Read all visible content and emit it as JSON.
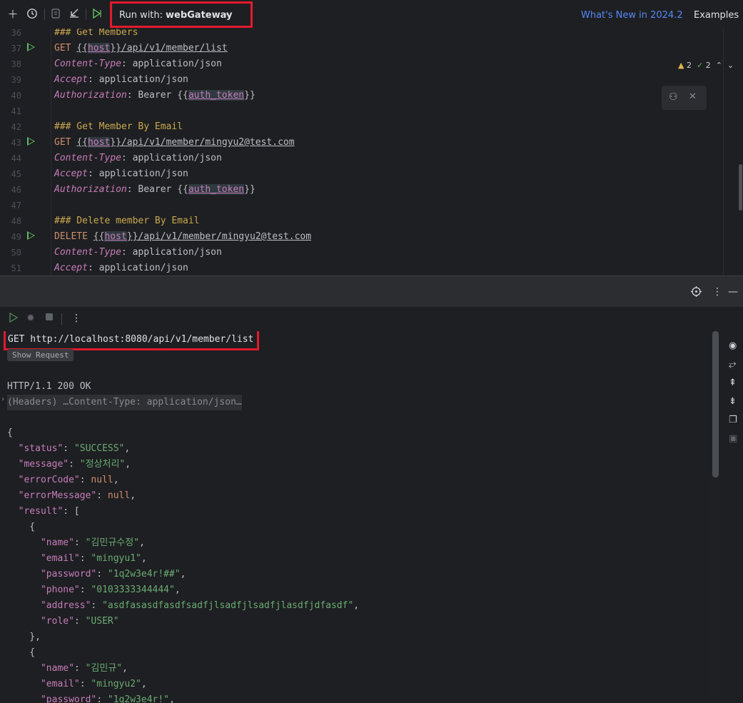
{
  "toolbar": {
    "run_with_label": "Run with:",
    "run_with_value": "webGateway",
    "whats_new": "What's New in 2024.2",
    "examples": "Examples"
  },
  "inspection": {
    "warnings": "2",
    "ok": "2"
  },
  "editor": {
    "lines": [
      {
        "n": "36",
        "tokens": [
          {
            "t": "### Get Members",
            "c": "comment"
          }
        ]
      },
      {
        "n": "37",
        "run": true,
        "tokens": [
          {
            "t": "GET ",
            "c": "method"
          },
          {
            "t": "{{",
            "c": "url"
          },
          {
            "t": "host",
            "c": "var"
          },
          {
            "t": "}}/api/v1/member/list",
            "c": "url"
          }
        ]
      },
      {
        "n": "38",
        "tokens": [
          {
            "t": "Content-Type",
            "c": "header"
          },
          {
            "t": ": application/json",
            "c": "plain"
          }
        ]
      },
      {
        "n": "39",
        "tokens": [
          {
            "t": "Accept",
            "c": "header"
          },
          {
            "t": ": application/json",
            "c": "plain"
          }
        ]
      },
      {
        "n": "40",
        "tokens": [
          {
            "t": "Authorization",
            "c": "header"
          },
          {
            "t": ": Bearer {{",
            "c": "plain"
          },
          {
            "t": "auth_token",
            "c": "var"
          },
          {
            "t": "}}",
            "c": "plain"
          }
        ]
      },
      {
        "n": "41",
        "tokens": []
      },
      {
        "n": "42",
        "tokens": [
          {
            "t": "### Get Member By Email",
            "c": "comment"
          }
        ]
      },
      {
        "n": "43",
        "run": true,
        "tokens": [
          {
            "t": "GET ",
            "c": "method"
          },
          {
            "t": "{{",
            "c": "url"
          },
          {
            "t": "host",
            "c": "var"
          },
          {
            "t": "}}/api/v1/member/mingyu2@test.com",
            "c": "url"
          }
        ]
      },
      {
        "n": "44",
        "tokens": [
          {
            "t": "Content-Type",
            "c": "header"
          },
          {
            "t": ": application/json",
            "c": "plain"
          }
        ]
      },
      {
        "n": "45",
        "tokens": [
          {
            "t": "Accept",
            "c": "header"
          },
          {
            "t": ": application/json",
            "c": "plain"
          }
        ]
      },
      {
        "n": "46",
        "tokens": [
          {
            "t": "Authorization",
            "c": "header"
          },
          {
            "t": ": Bearer {{",
            "c": "plain"
          },
          {
            "t": "auth_token",
            "c": "var"
          },
          {
            "t": "}}",
            "c": "plain"
          }
        ]
      },
      {
        "n": "47",
        "tokens": []
      },
      {
        "n": "48",
        "tokens": [
          {
            "t": "### Delete member By Email",
            "c": "comment"
          }
        ]
      },
      {
        "n": "49",
        "run": true,
        "tokens": [
          {
            "t": "DELETE ",
            "c": "method"
          },
          {
            "t": "{{",
            "c": "url"
          },
          {
            "t": "host",
            "c": "var"
          },
          {
            "t": "}}/api/v1/member/mingyu2@test.com",
            "c": "url"
          }
        ]
      },
      {
        "n": "50",
        "tokens": [
          {
            "t": "Content-Type",
            "c": "header"
          },
          {
            "t": ": application/json",
            "c": "plain"
          }
        ]
      },
      {
        "n": "51",
        "tokens": [
          {
            "t": "Accept",
            "c": "header"
          },
          {
            "t": ": application/json",
            "c": "plain"
          }
        ]
      }
    ]
  },
  "response": {
    "request_line": "GET http://localhost:8080/api/v1/member/list",
    "show_request": "Show Request",
    "status_line": "HTTP/1.1 200 OK",
    "headers_summary": "(Headers) …Content-Type: application/json…",
    "body_lines": [
      [
        {
          "t": "{",
          "c": "punc"
        }
      ],
      [
        {
          "t": "  ",
          "c": "punc"
        },
        {
          "t": "\"status\"",
          "c": "key"
        },
        {
          "t": ": ",
          "c": "punc"
        },
        {
          "t": "\"SUCCESS\"",
          "c": "str"
        },
        {
          "t": ",",
          "c": "punc"
        }
      ],
      [
        {
          "t": "  ",
          "c": "punc"
        },
        {
          "t": "\"message\"",
          "c": "key"
        },
        {
          "t": ": ",
          "c": "punc"
        },
        {
          "t": "\"정상처리\"",
          "c": "str"
        },
        {
          "t": ",",
          "c": "punc"
        }
      ],
      [
        {
          "t": "  ",
          "c": "punc"
        },
        {
          "t": "\"errorCode\"",
          "c": "key"
        },
        {
          "t": ": ",
          "c": "punc"
        },
        {
          "t": "null",
          "c": "null"
        },
        {
          "t": ",",
          "c": "punc"
        }
      ],
      [
        {
          "t": "  ",
          "c": "punc"
        },
        {
          "t": "\"errorMessage\"",
          "c": "key"
        },
        {
          "t": ": ",
          "c": "punc"
        },
        {
          "t": "null",
          "c": "null"
        },
        {
          "t": ",",
          "c": "punc"
        }
      ],
      [
        {
          "t": "  ",
          "c": "punc"
        },
        {
          "t": "\"result\"",
          "c": "key"
        },
        {
          "t": ": [",
          "c": "punc"
        }
      ],
      [
        {
          "t": "    {",
          "c": "punc"
        }
      ],
      [
        {
          "t": "      ",
          "c": "punc"
        },
        {
          "t": "\"name\"",
          "c": "key"
        },
        {
          "t": ": ",
          "c": "punc"
        },
        {
          "t": "\"김민규수정\"",
          "c": "str"
        },
        {
          "t": ",",
          "c": "punc"
        }
      ],
      [
        {
          "t": "      ",
          "c": "punc"
        },
        {
          "t": "\"email\"",
          "c": "key"
        },
        {
          "t": ": ",
          "c": "punc"
        },
        {
          "t": "\"mingyu1\"",
          "c": "str"
        },
        {
          "t": ",",
          "c": "punc"
        }
      ],
      [
        {
          "t": "      ",
          "c": "punc"
        },
        {
          "t": "\"password\"",
          "c": "key"
        },
        {
          "t": ": ",
          "c": "punc"
        },
        {
          "t": "\"1q2w3e4r!##\"",
          "c": "str"
        },
        {
          "t": ",",
          "c": "punc"
        }
      ],
      [
        {
          "t": "      ",
          "c": "punc"
        },
        {
          "t": "\"phone\"",
          "c": "key"
        },
        {
          "t": ": ",
          "c": "punc"
        },
        {
          "t": "\"0103333344444\"",
          "c": "str"
        },
        {
          "t": ",",
          "c": "punc"
        }
      ],
      [
        {
          "t": "      ",
          "c": "punc"
        },
        {
          "t": "\"address\"",
          "c": "key"
        },
        {
          "t": ": ",
          "c": "punc"
        },
        {
          "t": "\"asdfasasdfasdfsadfjlsadfjlsadfjlasdfjdfasdf\"",
          "c": "str"
        },
        {
          "t": ",",
          "c": "punc"
        }
      ],
      [
        {
          "t": "      ",
          "c": "punc"
        },
        {
          "t": "\"role\"",
          "c": "key"
        },
        {
          "t": ": ",
          "c": "punc"
        },
        {
          "t": "\"USER\"",
          "c": "str"
        }
      ],
      [
        {
          "t": "    },",
          "c": "punc"
        }
      ],
      [
        {
          "t": "    {",
          "c": "punc"
        }
      ],
      [
        {
          "t": "      ",
          "c": "punc"
        },
        {
          "t": "\"name\"",
          "c": "key"
        },
        {
          "t": ": ",
          "c": "punc"
        },
        {
          "t": "\"김민규\"",
          "c": "str"
        },
        {
          "t": ",",
          "c": "punc"
        }
      ],
      [
        {
          "t": "      ",
          "c": "punc"
        },
        {
          "t": "\"email\"",
          "c": "key"
        },
        {
          "t": ": ",
          "c": "punc"
        },
        {
          "t": "\"mingyu2\"",
          "c": "str"
        },
        {
          "t": ",",
          "c": "punc"
        }
      ],
      [
        {
          "t": "      ",
          "c": "punc"
        },
        {
          "t": "\"password\"",
          "c": "key"
        },
        {
          "t": ": ",
          "c": "punc"
        },
        {
          "t": "\"1q2w3e4r!\"",
          "c": "str"
        },
        {
          "t": ",",
          "c": "punc"
        }
      ]
    ]
  },
  "icons": {
    "add": "plus-icon",
    "history": "clock-icon",
    "copy": "copy-icon",
    "import": "import-icon",
    "run_all": "run-all-icon",
    "target": "crosshair-icon",
    "more": "more-vert-icon",
    "minimize": "minimize-icon"
  },
  "colors": {
    "highlight_box": "#e21a2c",
    "link": "#548af7",
    "run_green": "#5fb865"
  }
}
